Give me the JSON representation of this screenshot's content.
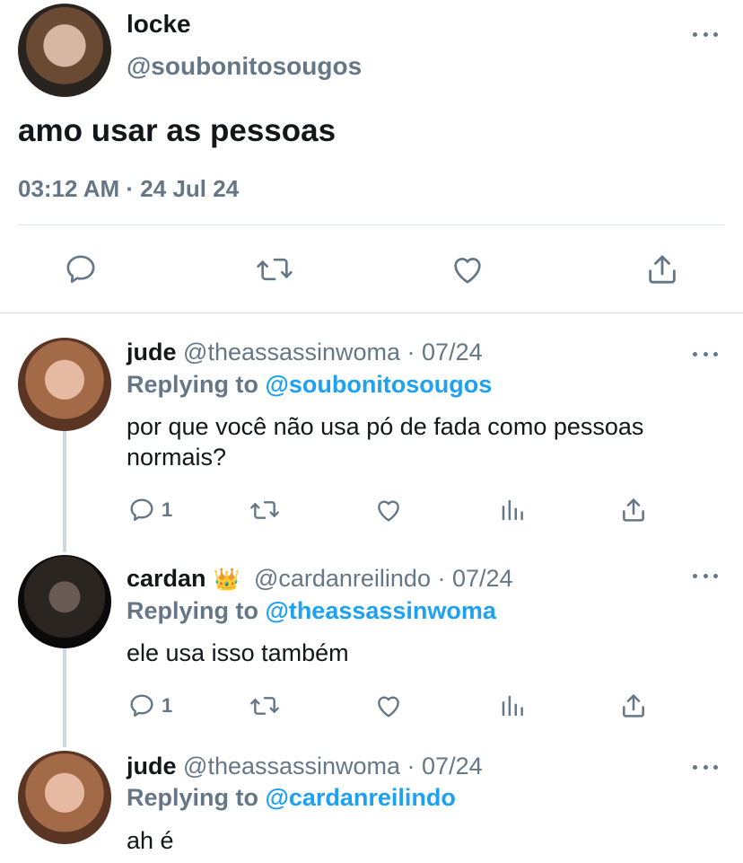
{
  "colors": {
    "text": "#14171a",
    "secondary": "#657786",
    "accent": "#1da1f2",
    "divider": "#e1e8ed"
  },
  "main_tweet": {
    "name": "locke",
    "handle": "@soubonitosougos",
    "text": "amo usar as pessoas",
    "meta": "03:12 AM · 24 Jul 24",
    "actions": [
      "reply-icon",
      "retweet-icon",
      "like-icon",
      "share-icon"
    ]
  },
  "replies": [
    {
      "name": "jude",
      "handle_date": "@theassassinwoma · 07/24",
      "replying_label": "Replying to ",
      "replying_to": "@soubonitosougos",
      "text": "por que você não usa pó de fada como pessoas normais?",
      "reply_count": "1",
      "actions": [
        "reply-icon",
        "retweet-icon",
        "like-icon",
        "analytics-icon",
        "share-icon"
      ]
    },
    {
      "name": "cardan",
      "badge": "👑",
      "handle_date": "@cardanreilindo · 07/24",
      "replying_label": "Replying to ",
      "replying_to": "@theassassinwoma",
      "text": "ele usa isso também",
      "reply_count": "1",
      "actions": [
        "reply-icon",
        "retweet-icon",
        "like-icon",
        "analytics-icon",
        "share-icon"
      ]
    },
    {
      "name": "jude",
      "handle_date": "@theassassinwoma · 07/24",
      "replying_label": "Replying to ",
      "replying_to": "@cardanreilindo",
      "text": "ah é"
    }
  ]
}
